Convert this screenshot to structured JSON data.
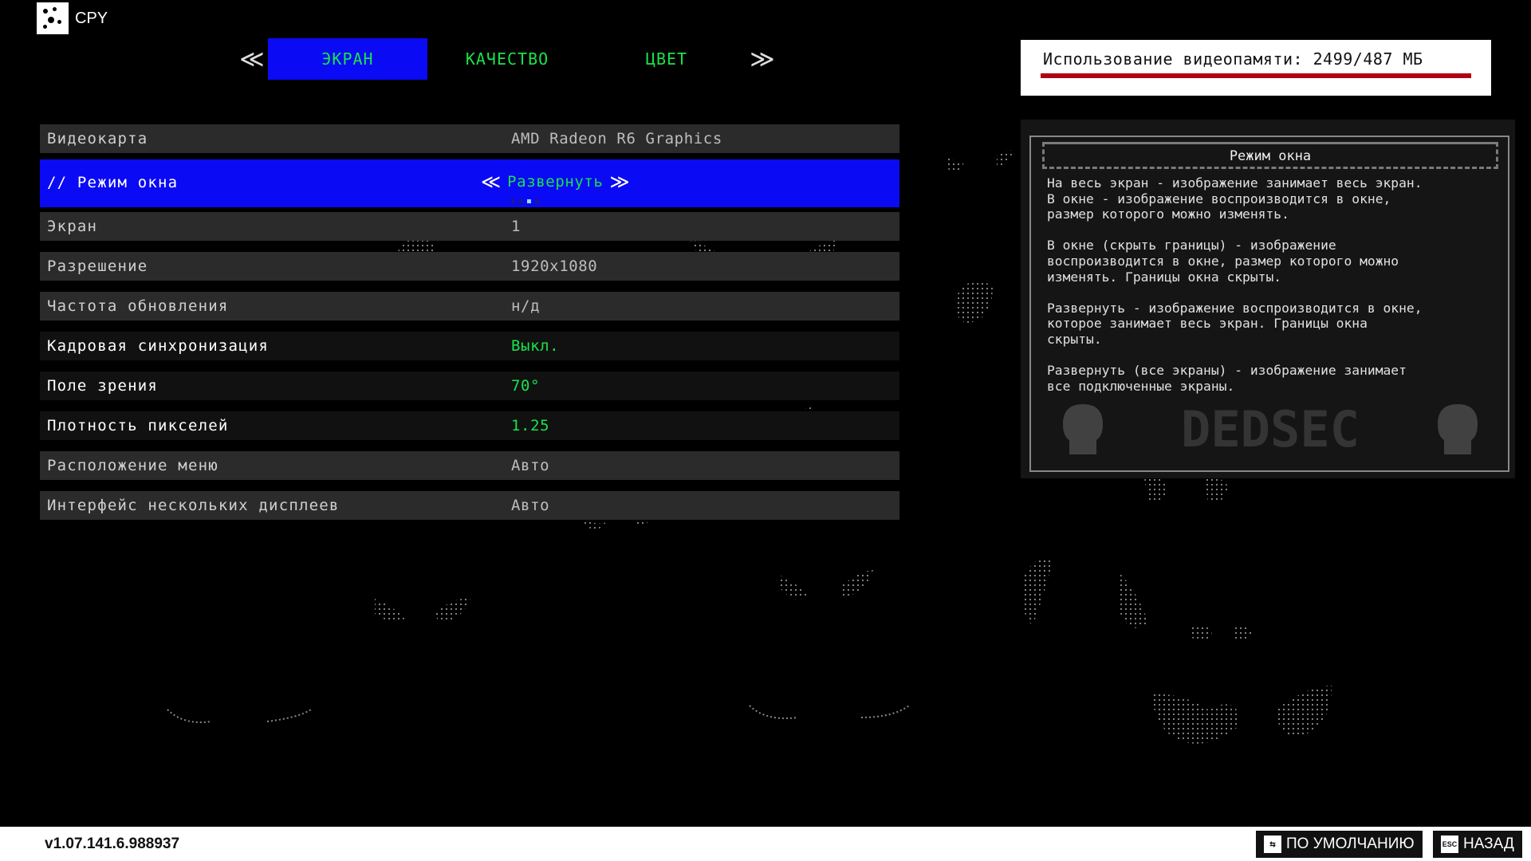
{
  "app": {
    "logo_text": "CPY"
  },
  "tabs": {
    "left_arrow": "≪",
    "right_arrow": "≫",
    "items": [
      {
        "label": "ЭКРАН",
        "active": true
      },
      {
        "label": "КАЧЕСТВО",
        "active": false
      },
      {
        "label": "ЦВЕТ",
        "active": false
      }
    ]
  },
  "vram": {
    "text": "Использование видеопамяти: 2499/487 МБ"
  },
  "settings": {
    "rows": [
      {
        "label": "Видеокарта",
        "value": "AMD Radeon R6 Graphics"
      },
      {
        "label": "// Режим окна",
        "value": "Развернуть"
      },
      {
        "label": "Экран",
        "value": "1"
      },
      {
        "label": "Разрешение",
        "value": "1920x1080"
      },
      {
        "label": "Частота обновления",
        "value": "н/д"
      },
      {
        "label": "Кадровая синхронизация",
        "value": "Выкл."
      },
      {
        "label": "Поле зрения",
        "value": "70°"
      },
      {
        "label": "Плотность пикселей",
        "value": "1.25"
      },
      {
        "label": "Расположение меню",
        "value": "Авто"
      },
      {
        "label": "Интерфейс нескольких дисплеев",
        "value": "Авто"
      }
    ],
    "selector_left": "≪",
    "selector_right": "≫"
  },
  "info": {
    "title": "Режим окна",
    "paragraphs": [
      "На весь экран - изображение занимает весь экран.\nВ окне - изображение воспроизводится в окне,\nразмер которого можно изменять.",
      "В окне (скрыть границы) - изображение\nвоспроизводится в окне, размер которого можно\nизменять. Границы окна скрыты.",
      "Развернуть - изображение воспроизводится в окне,\nкоторое занимает весь экран. Границы окна\nскрыты.",
      "Развернуть (все экраны) - изображение занимает\nвсе подключенные экраны."
    ],
    "watermark_text": "DEDSEC"
  },
  "footer": {
    "version": "v1.07.141.6.988937",
    "default_label": "ПО УМОЛЧАНИЮ",
    "default_key": "⇆",
    "back_label": "НАЗАД",
    "back_key": "ESC"
  },
  "colors": {
    "accent_blue": "#0a0af5",
    "green": "#19e34a",
    "vram_bar": "#b00012"
  }
}
